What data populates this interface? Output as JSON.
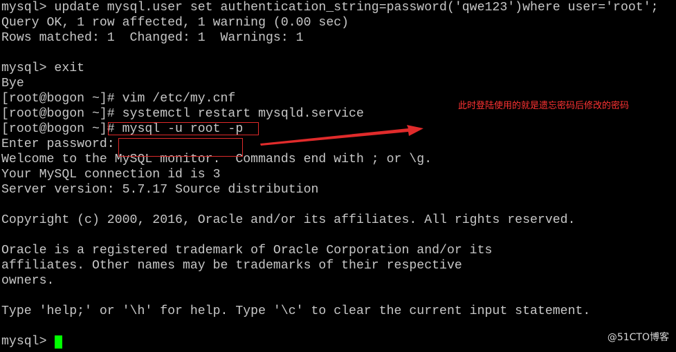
{
  "terminal": {
    "lines": [
      "mysql> update mysql.user set authentication_string=password('qwe123')where user='root';",
      "Query OK, 1 row affected, 1 warning (0.00 sec)",
      "Rows matched: 1  Changed: 1  Warnings: 1",
      "",
      "mysql> exit",
      "Bye",
      "[root@bogon ~]# vim /etc/my.cnf",
      "[root@bogon ~]# systemctl restart mysqld.service",
      "[root@bogon ~]# mysql -u root -p",
      "Enter password: ",
      "Welcome to the MySQL monitor.  Commands end with ; or \\g.",
      "Your MySQL connection id is 3",
      "Server version: 5.7.17 Source distribution",
      "",
      "Copyright (c) 2000, 2016, Oracle and/or its affiliates. All rights reserved.",
      "",
      "Oracle is a registered trademark of Oracle Corporation and/or its",
      "affiliates. Other names may be trademarks of their respective",
      "owners.",
      "",
      "Type 'help;' or '\\h' for help. Type '\\c' to clear the current input statement.",
      ""
    ],
    "current_prompt": "mysql> "
  },
  "annotation": {
    "note": "此时登陆使用的就是遗忘密码后修改的密码",
    "color": "#e02b2b"
  },
  "watermark": "@51CTO博客",
  "colors": {
    "background": "#000000",
    "text": "#c7c7c7",
    "cursor": "#00ff00"
  }
}
